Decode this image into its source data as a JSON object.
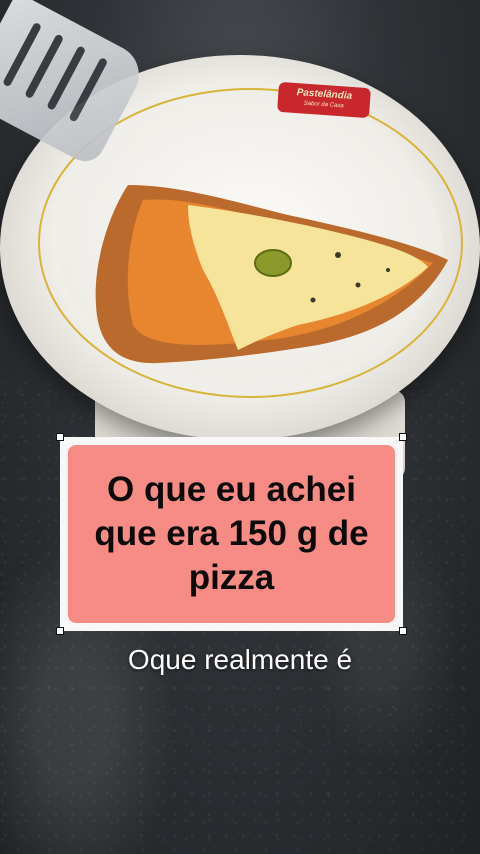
{
  "photo": {
    "plate_brand": "Pastelândia",
    "plate_brand_sub": "Sabor da Casa"
  },
  "overlay": {
    "caption": "O que eu achei que era 150 g de pizza",
    "subtitle": "Oque realmente é"
  },
  "colors": {
    "caption_card_bg": "#f78c86",
    "caption_text": "#0b0b0b",
    "subtitle_text": "#ffffff",
    "plate_rim": "#d9b43a"
  }
}
